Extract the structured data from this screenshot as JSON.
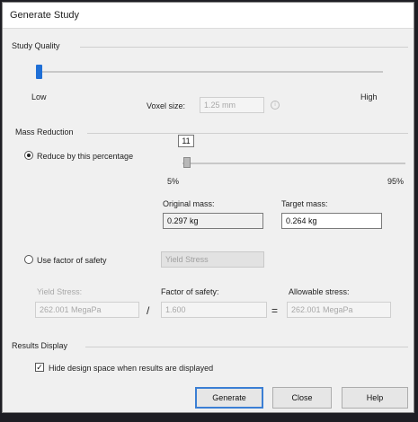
{
  "window": {
    "title": "Generate Study"
  },
  "study_quality": {
    "section_label": "Study Quality",
    "low_label": "Low",
    "high_label": "High",
    "voxel_label": "Voxel size:",
    "voxel_value": "1.25 mm",
    "slider_level": 0.0
  },
  "mass_reduction": {
    "section_label": "Mass Reduction",
    "reduce_option_label": "Reduce by this percentage",
    "reduce_selected": true,
    "percentage_value": "11",
    "min_label": "5%",
    "max_label": "95%",
    "original_mass_label": "Original mass:",
    "original_mass_value": "0.297 kg",
    "target_mass_label": "Target mass:",
    "target_mass_value": "0.264 kg",
    "safety_option_label": "Use factor of safety",
    "safety_selected": false,
    "safety_dropdown_value": "Yield Stress",
    "yield_label": "Yield Stress:",
    "yield_value": "262.001 MegaPa",
    "divide_symbol": "/",
    "factor_label": "Factor of safety:",
    "factor_value": "1.600",
    "equals_symbol": "=",
    "allowable_label": "Allowable stress:",
    "allowable_value": "262.001 MegaPa"
  },
  "results_display": {
    "section_label": "Results Display",
    "hide_option_label": "Hide design space when results are displayed",
    "hide_checked": true
  },
  "buttons": {
    "generate": "Generate",
    "close": "Close",
    "help": "Help"
  }
}
